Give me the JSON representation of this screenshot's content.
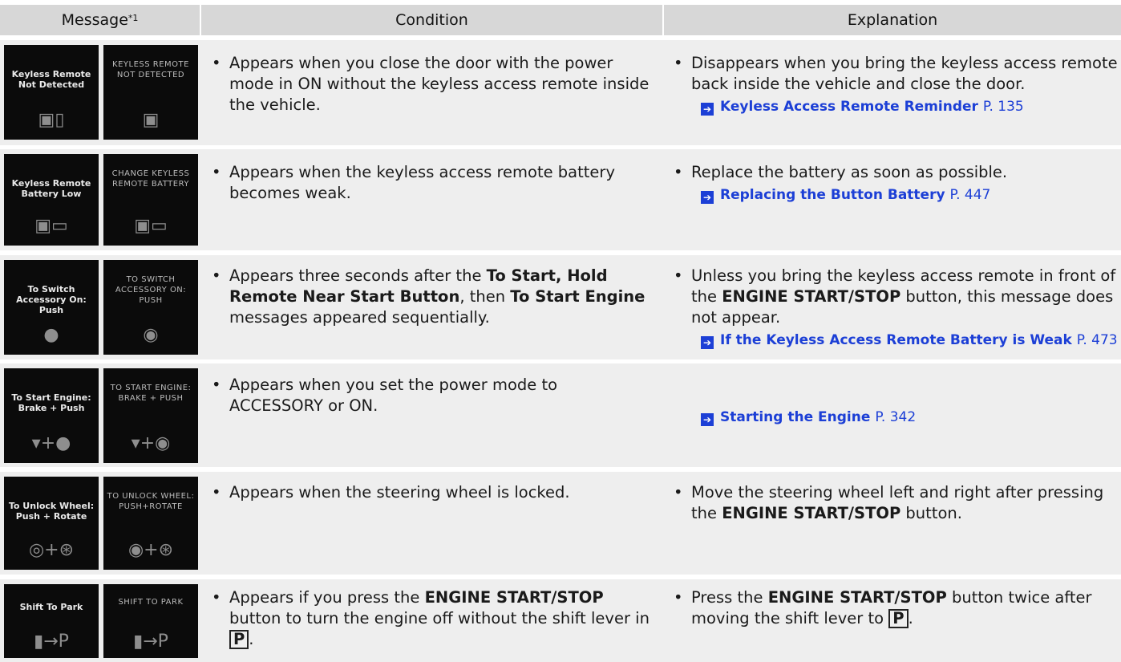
{
  "header": {
    "message": "Message",
    "message_note": "*1",
    "condition": "Condition",
    "explanation": "Explanation"
  },
  "rows": [
    {
      "thumb_left": "Keyless Remote Not Detected",
      "thumb_right": "KEYLESS REMOTE NOT DETECTED",
      "thumb_icon": "key-fob-icon",
      "condition": "Appears when you close the door with the power mode in ON without the keyless access remote inside the vehicle.",
      "explanation": "Disappears when you bring the keyless access remote back inside the vehicle and close the door.",
      "ref_title": "Keyless Access Remote Reminder",
      "ref_page": "P. 135"
    },
    {
      "thumb_left": "Keyless Remote Battery Low",
      "thumb_right": "CHANGE KEYLESS REMOTE BATTERY",
      "thumb_icon": "battery-icon",
      "condition": "Appears when the keyless access remote battery becomes weak.",
      "explanation": "Replace the battery as soon as possible.",
      "ref_title": "Replacing the Button Battery",
      "ref_page": "P. 447"
    },
    {
      "thumb_left": "To Switch Accessory On: Push",
      "thumb_right": "TO SWITCH ACCESSORY ON: PUSH",
      "thumb_icon": "start-button-icon",
      "condition_a": "Appears three seconds after the ",
      "condition_b": "To Start, Hold Remote Near Start Button",
      "condition_c": ", then ",
      "condition_d": "To Start Engine",
      "condition_e": " messages appeared sequentially.",
      "explanation_a": "Unless you bring the keyless access remote in front of the ",
      "explanation_b": "ENGINE START/STOP",
      "explanation_c": " button, this message does not appear.",
      "ref_title": "If the Keyless Access Remote Battery is Weak",
      "ref_page": "P. 473"
    },
    {
      "thumb_left": "To Start Engine: Brake + Push",
      "thumb_right": "TO START ENGINE: BRAKE + PUSH",
      "thumb_icon": "brake-start-icon",
      "condition": "Appears when you set the power mode to ACCESSORY or ON.",
      "ref_title": "Starting the Engine",
      "ref_page": "P. 342"
    },
    {
      "thumb_left": "To Unlock Wheel: Push + Rotate",
      "thumb_right": "TO UNLOCK WHEEL: PUSH+ROTATE",
      "thumb_icon": "steering-wheel-icon",
      "condition": "Appears when the steering wheel is locked.",
      "explanation_a": "Move the steering wheel left and right after pressing the ",
      "explanation_b": "ENGINE START/STOP",
      "explanation_c": " button."
    },
    {
      "thumb_left": "Shift To Park",
      "thumb_right": "SHIFT TO PARK",
      "thumb_icon": "shift-park-icon",
      "condition_a": "Appears if you press the ",
      "condition_b": "ENGINE START/STOP",
      "condition_c": " button to turn the engine off without the shift lever in ",
      "condition_box": "P",
      "condition_end": ".",
      "explanation_a": "Press the ",
      "explanation_b": "ENGINE START/STOP",
      "explanation_c": " button twice after moving the shift lever to ",
      "explanation_box": "P",
      "explanation_end": "."
    }
  ]
}
